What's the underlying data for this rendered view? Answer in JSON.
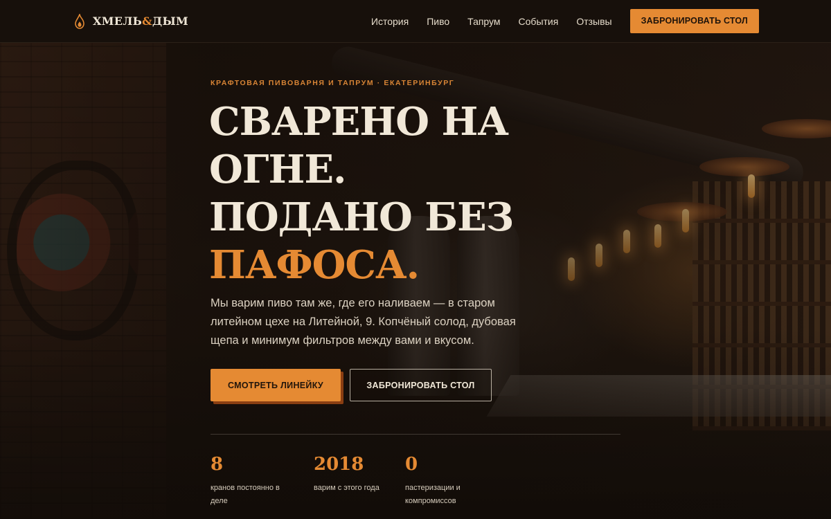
{
  "brand": {
    "name_part1": "ХМЕЛЬ",
    "name_amp": "&",
    "name_part2": "ДЫМ",
    "icon": "flame-icon",
    "accent_color": "#e58a33"
  },
  "nav": {
    "items": [
      {
        "label": "История"
      },
      {
        "label": "Пиво"
      },
      {
        "label": "Тапрум"
      },
      {
        "label": "События"
      },
      {
        "label": "Отзывы"
      }
    ],
    "cta_label": "ЗАБРОНИРОВАТЬ СТОЛ"
  },
  "hero": {
    "eyebrow": "КРАФТОВАЯ ПИВОВАРНЯ И ТАПРУМ · ЕКАТЕРИНБУРГ",
    "headline_lines": [
      "СВАРЕНО НА",
      "ОГНЕ.",
      "ПОДАНО БЕЗ"
    ],
    "headline_accent": "ПАФОСА.",
    "lead": "Мы варим пиво там же, где его наливаем — в старом литейном цехе на Литейной, 9. Копчёный солод, дубовая щепа и минимум фильтров между вами и вкусом.",
    "primary_cta": "СМОТРЕТЬ ЛИНЕЙКУ",
    "secondary_cta": "ЗАБРОНИРОВАТЬ СТОЛ"
  },
  "stats": [
    {
      "value": "8",
      "label": "кранов постоянно в деле"
    },
    {
      "value": "2018",
      "label": "варим с этого года"
    },
    {
      "value": "0",
      "label": "пастеризации и компромиссов"
    }
  ],
  "colors": {
    "header_bg": "#17100b",
    "text_light": "#f1e8d8",
    "accent": "#e58a33"
  }
}
